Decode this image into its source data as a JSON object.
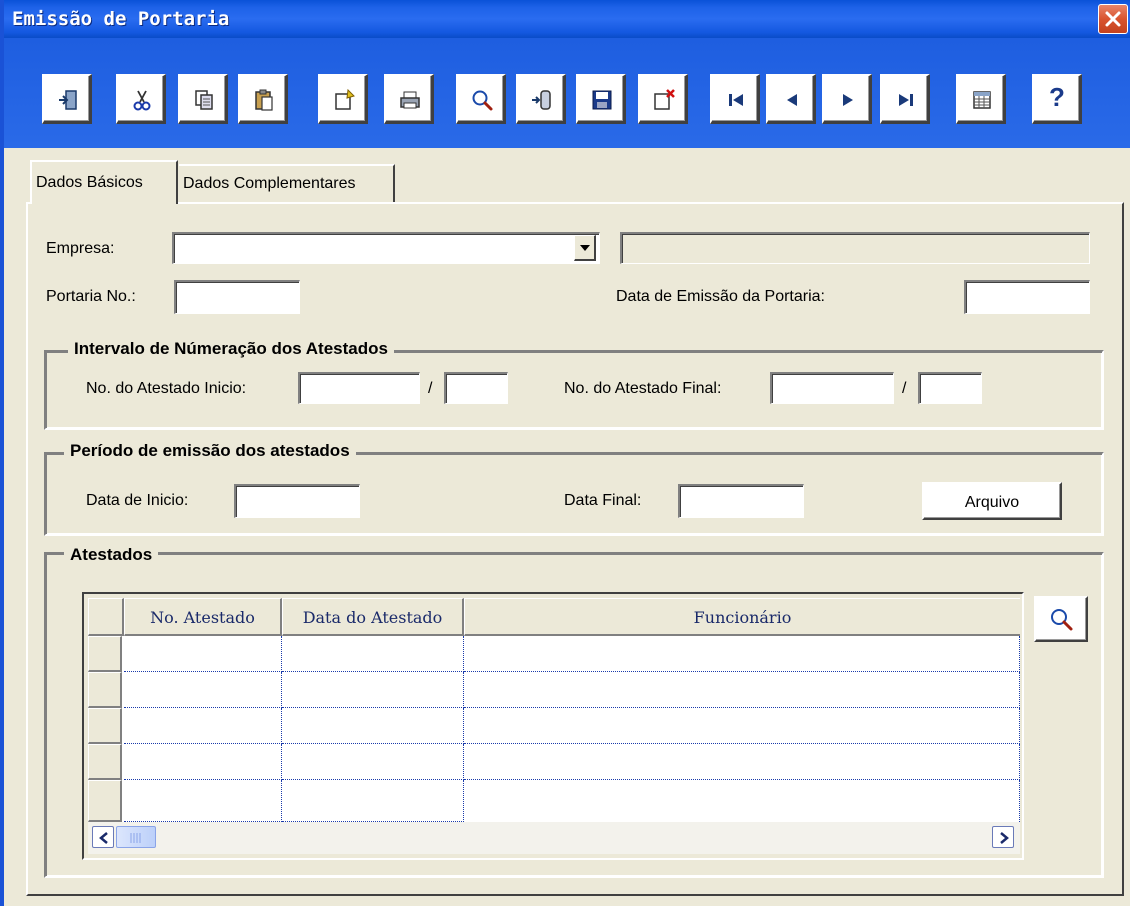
{
  "window": {
    "title": "Emissão de Portaria"
  },
  "toolbar": {
    "buttons": [
      {
        "name": "exit",
        "icon": "exit-door-icon"
      },
      {
        "name": "cut",
        "icon": "scissors-icon"
      },
      {
        "name": "copy",
        "icon": "copy-icon"
      },
      {
        "name": "paste",
        "icon": "paste-icon"
      },
      {
        "name": "new",
        "icon": "new-record-icon"
      },
      {
        "name": "print",
        "icon": "printer-icon"
      },
      {
        "name": "search",
        "icon": "magnifier-icon"
      },
      {
        "name": "import",
        "icon": "import-icon"
      },
      {
        "name": "save",
        "icon": "floppy-disk-icon"
      },
      {
        "name": "delete",
        "icon": "delete-record-icon"
      },
      {
        "name": "first",
        "icon": "first-record-icon"
      },
      {
        "name": "prior",
        "icon": "prior-record-icon"
      },
      {
        "name": "next",
        "icon": "next-record-icon"
      },
      {
        "name": "last",
        "icon": "last-record-icon"
      },
      {
        "name": "grid",
        "icon": "table-view-icon"
      },
      {
        "name": "help",
        "icon": "help-icon",
        "label": "?"
      }
    ]
  },
  "tabs": [
    {
      "label": "Dados Básicos",
      "active": true
    },
    {
      "label": "Dados Complementares",
      "active": false
    }
  ],
  "form": {
    "empresa_label": "Empresa:",
    "empresa_value": "",
    "empresa_desc": "",
    "portaria_label": "Portaria No.:",
    "portaria_value": "",
    "data_emissao_label": "Data de Emissão da Portaria:",
    "data_emissao_value": ""
  },
  "intervalo": {
    "title": "Intervalo de Númeração dos Atestados",
    "inicio_label": "No. do Atestado Inicio:",
    "final_label": "No. do Atestado Final:",
    "separator": "/"
  },
  "periodo": {
    "title": "Período de emissão dos atestados",
    "data_inicio_label": "Data de Inicio:",
    "data_final_label": "Data Final:",
    "arquivo_button": "Arquivo"
  },
  "atestados": {
    "title": "Atestados",
    "columns": [
      "No. Atestado",
      "Data do Atestado",
      "Funcionário"
    ],
    "rows": [
      [
        "",
        "",
        ""
      ],
      [
        "",
        "",
        ""
      ],
      [
        "",
        "",
        ""
      ],
      [
        "",
        "",
        ""
      ],
      [
        "",
        "",
        ""
      ]
    ]
  },
  "colors": {
    "titlebar": "#1e62e8",
    "window_bg": "#ece9d8",
    "grid_header_text": "#1a2a6a"
  }
}
